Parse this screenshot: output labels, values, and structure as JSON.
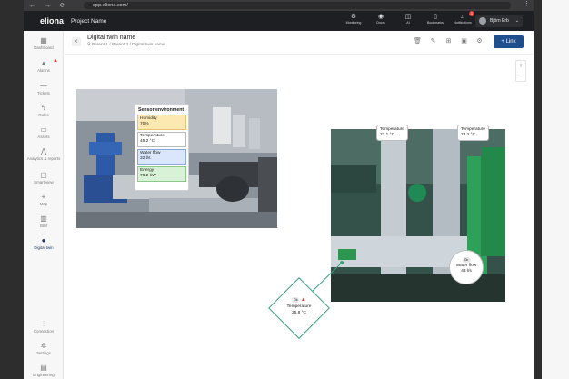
{
  "browser": {
    "url": "app.eliona.com/",
    "nav": "← → ⟳"
  },
  "app": {
    "logo": "eliona",
    "project": "Project Name"
  },
  "topbar": {
    "items": [
      {
        "icon": "monitoring-icon",
        "glyph": "⚙",
        "label": "Monitoring"
      },
      {
        "icon": "doors-icon",
        "glyph": "◉",
        "label": "Doors"
      },
      {
        "icon": "ai-icon",
        "glyph": "◫",
        "label": "AI"
      },
      {
        "icon": "bookmark-icon",
        "glyph": "▯",
        "label": "Bookmarks"
      },
      {
        "icon": "bell-icon",
        "glyph": "♫",
        "label": "Notifications",
        "badge": "3"
      }
    ],
    "user": "Björn Erb"
  },
  "sidebar": {
    "items": [
      {
        "glyph": "▦",
        "label": "Dashboard"
      },
      {
        "glyph": "▲",
        "label": "Alarms",
        "warn": true
      },
      {
        "glyph": "⁓",
        "label": "Tickets"
      },
      {
        "glyph": "ϟ",
        "label": "Rules"
      },
      {
        "glyph": "▭",
        "label": "Assets"
      },
      {
        "glyph": "⋀",
        "label": "Analytics & reports"
      },
      {
        "glyph": "▢",
        "label": "Smart view"
      },
      {
        "glyph": "⌖",
        "label": "Map"
      },
      {
        "glyph": "▥",
        "label": "BIM"
      },
      {
        "glyph": "●",
        "label": "Digital twin"
      }
    ],
    "bottom": [
      {
        "glyph": "⫶",
        "label": "Connection"
      },
      {
        "glyph": "✲",
        "label": "Settings"
      },
      {
        "glyph": "▤",
        "label": "Engineering"
      }
    ]
  },
  "page": {
    "back": "‹",
    "title": "Digital twin name",
    "breadcrumb": "⚲  Parent 1  /  Parent 2  /  Digital twin name",
    "link_button": "+ Link"
  },
  "sensor_panel": {
    "title": "Sensor environment",
    "rows": [
      {
        "label": "Humidity",
        "value": "70%",
        "style": "yellow"
      },
      {
        "label": "Temperature",
        "value": "45.2 °C",
        "style": "white"
      },
      {
        "label": "Water flow",
        "value": "32 l/s",
        "style": "blue"
      },
      {
        "label": "Energy",
        "value": "70.2 kW",
        "style": "green"
      }
    ]
  },
  "bubbles": {
    "temp_left": {
      "label": "Temperature",
      "value": "22.1 °C"
    },
    "temp_right": {
      "label": "Temperature",
      "value": "23.2 °C"
    },
    "water_flow": {
      "ok": "Ok",
      "label": "Water flow",
      "value": "43 l/s"
    },
    "diamond": {
      "ok": "Ok",
      "label": "Temperature",
      "value": "25.8 °C"
    }
  }
}
